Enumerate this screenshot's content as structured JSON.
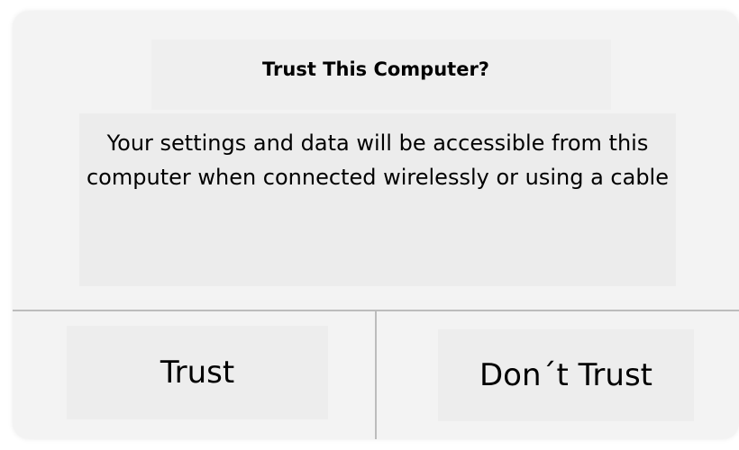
{
  "dialog": {
    "title": "Trust This Computer?",
    "message": "Your settings and data will be accessible from this computer when connected wirelessly or using a cable",
    "buttons": {
      "trust": "Trust",
      "dont_trust": "Don´t Trust"
    }
  }
}
